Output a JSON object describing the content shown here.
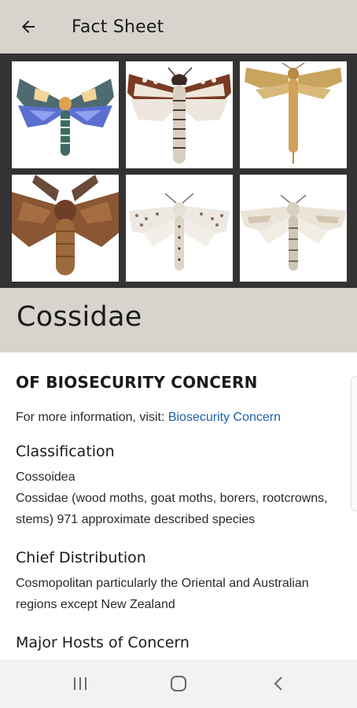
{
  "appbar": {
    "title": "Fact Sheet",
    "back_icon": "arrow-left-icon"
  },
  "gallery": {
    "images": [
      {
        "name": "moth-image-1",
        "depicts": "moth-specimen"
      },
      {
        "name": "moth-image-2",
        "depicts": "moth-specimen"
      },
      {
        "name": "moth-image-3",
        "depicts": "moth-specimen"
      },
      {
        "name": "moth-image-4",
        "depicts": "moth-specimen"
      },
      {
        "name": "moth-image-5",
        "depicts": "moth-specimen"
      },
      {
        "name": "moth-image-6",
        "depicts": "moth-specimen"
      }
    ]
  },
  "species": {
    "title": "Cossidae"
  },
  "content": {
    "concern_heading": "OF BIOSECURITY CONCERN",
    "info_prefix": "For more information, visit: ",
    "info_link": "Biosecurity Concern",
    "classification": {
      "title": "Classification",
      "line1": "Cossoidea",
      "line2": "Cossidae (wood moths, goat moths, borers, rootcrowns, stems) 971 approximate described species"
    },
    "distribution": {
      "title": "Chief Distribution",
      "body": "Cosmopolitan particularly the Oriental and Australian regions except New Zealand"
    },
    "hosts": {
      "title": "Major Hosts of Concern"
    }
  },
  "navbar": {
    "recents_icon": "recent-apps-icon",
    "home_icon": "home-icon",
    "back_icon": "back-chevron-icon"
  },
  "colors": {
    "appbar_bg": "#d7d4cd",
    "gallery_bg": "#333333",
    "link": "#1b5ea8",
    "navbar_bg": "#f2f2f2"
  }
}
